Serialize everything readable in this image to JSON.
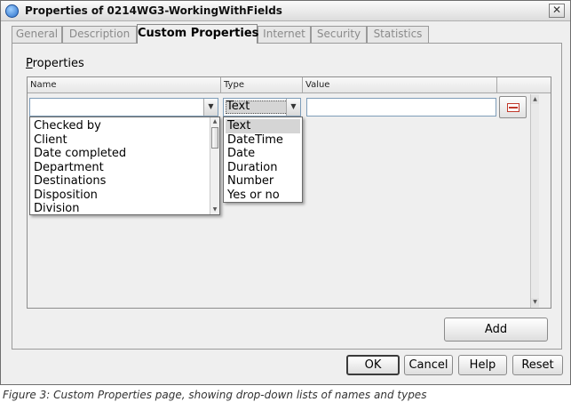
{
  "window": {
    "title": "Properties of 0214WG3-WorkingWithFields",
    "close_glyph": "✕"
  },
  "tabs": [
    {
      "label": "General",
      "active": false
    },
    {
      "label": "Description",
      "active": false
    },
    {
      "label": "Custom Properties",
      "active": true
    },
    {
      "label": "Internet",
      "active": false
    },
    {
      "label": "Security",
      "active": false
    },
    {
      "label": "Statistics",
      "active": false
    }
  ],
  "properties": {
    "group_label_mnemonic": "P",
    "group_label_rest": "roperties",
    "columns": {
      "name": "Name",
      "type": "Type",
      "value": "Value"
    },
    "name_value": "",
    "type_value": "Text",
    "value_value": ""
  },
  "name_dropdown": {
    "items": [
      "Checked by",
      "Client",
      "Date completed",
      "Department",
      "Destinations",
      "Disposition",
      "Division"
    ]
  },
  "type_dropdown": {
    "items": [
      "Text",
      "DateTime",
      "Date",
      "Duration",
      "Number",
      "Yes or no"
    ],
    "selected": "Text"
  },
  "buttons": {
    "add": "Add",
    "ok": "OK",
    "cancel": "Cancel",
    "help": "Help",
    "reset": "Reset"
  },
  "caption": "Figure 3: Custom Properties page, showing drop-down lists of names and types"
}
